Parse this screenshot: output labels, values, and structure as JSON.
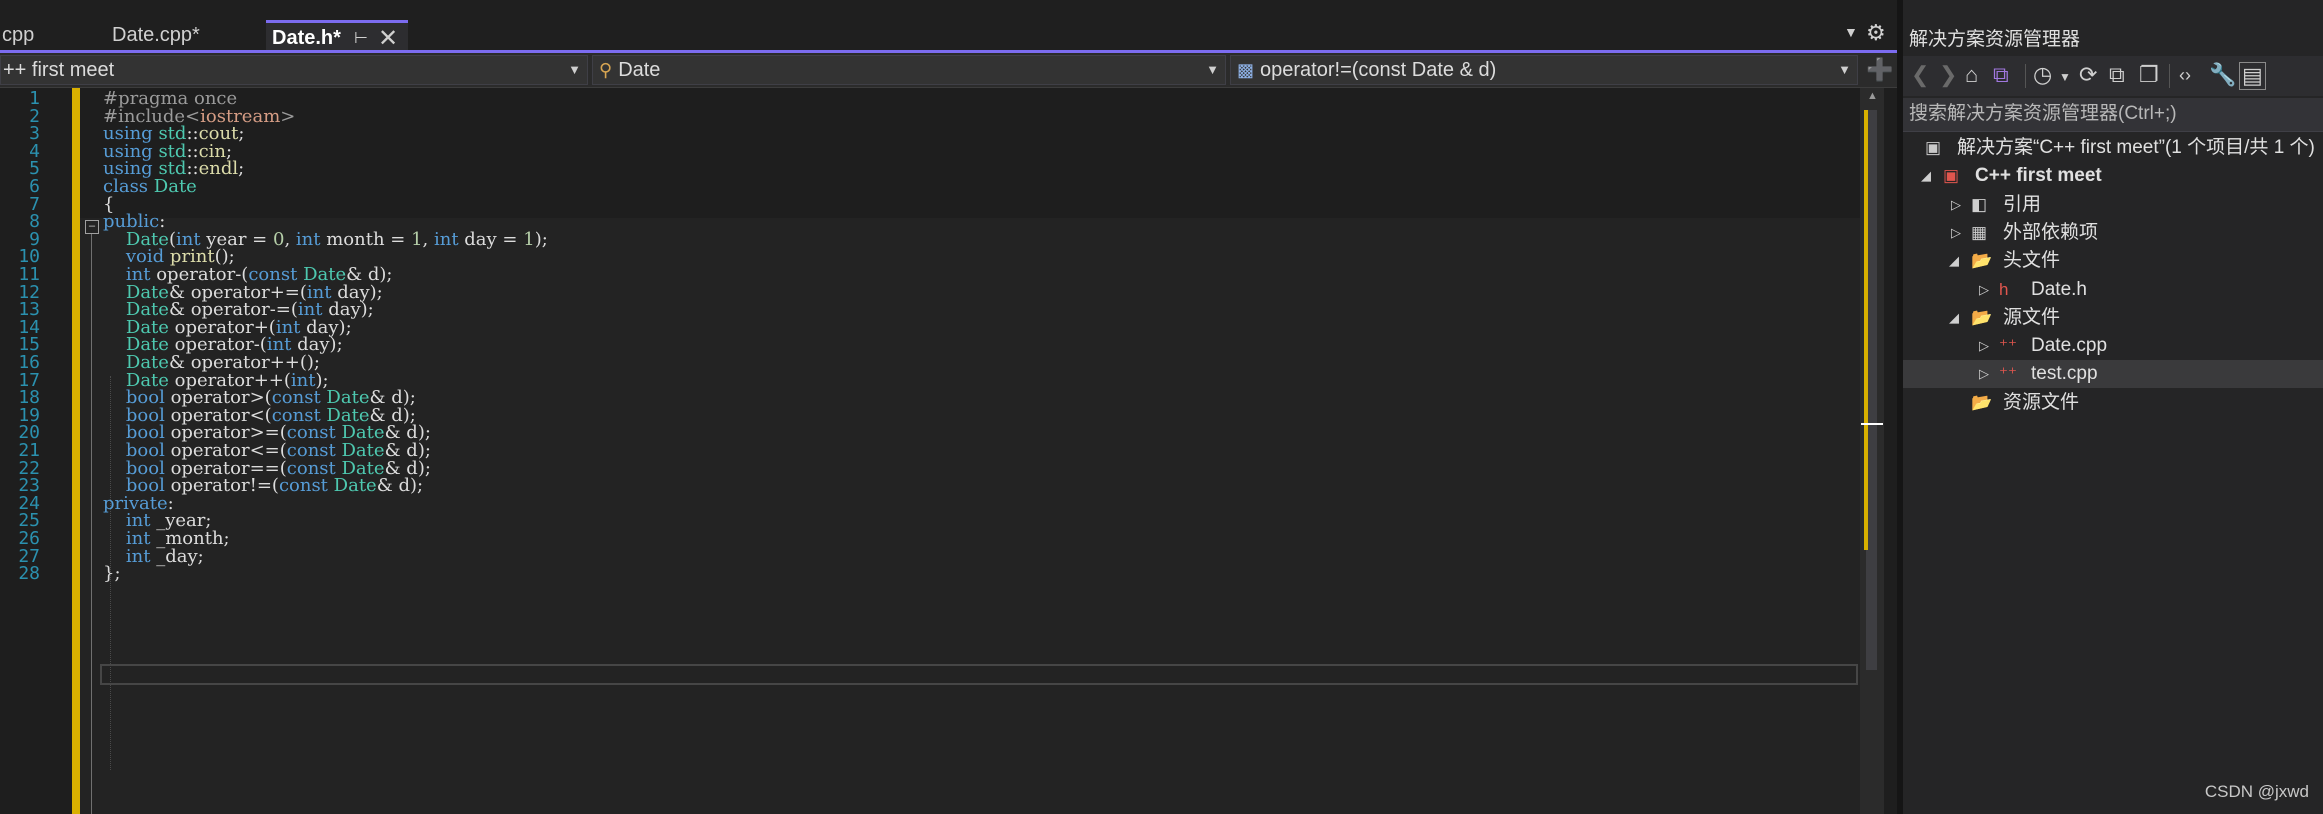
{
  "tabs": [
    {
      "label": "cpp",
      "active": false
    },
    {
      "label": "Date.cpp*",
      "active": false
    },
    {
      "label": "Date.h*",
      "active": true
    }
  ],
  "tab_icons": {
    "pin": "pin-icon",
    "close": "close-icon",
    "dropdown": "chevron-down-icon",
    "settings": "gear-icon"
  },
  "navbar": {
    "project": "++ first meet",
    "class": "Date",
    "member": "operator!=(const Date & d)"
  },
  "editor": {
    "line_numbers": [
      "1",
      "2",
      "3",
      "4",
      "5",
      "6",
      "7",
      "8",
      "9",
      "10",
      "11",
      "12",
      "13",
      "14",
      "15",
      "16",
      "17",
      "18",
      "19",
      "20",
      "21",
      "22",
      "23",
      "24",
      "25",
      "26",
      "27",
      "28"
    ],
    "current_line": "23",
    "code": [
      "#pragma once",
      "#include<iostream>",
      "using std::cout;",
      "using std::cin;",
      "using std::endl;",
      "class Date",
      "{",
      "public:",
      "    Date(int year = 0, int month = 1, int day = 1);",
      "    void print();",
      "    int operator-(const Date& d);",
      "    Date& operator+=(int day);",
      "    Date& operator-=(int day);",
      "    Date operator+(int day);",
      "    Date operator-(int day);",
      "    Date& operator++();",
      "    Date operator++(int);",
      "    bool operator>(const Date& d);",
      "    bool operator<(const Date& d);",
      "    bool operator>=(const Date& d);",
      "    bool operator<=(const Date& d);",
      "    bool operator==(const Date& d);",
      "    bool operator!=(const Date& d);",
      "private:",
      "    int _year;",
      "    int _month;",
      "    int _day;",
      "};"
    ],
    "colors": {
      "keyword": "#569cd6",
      "type": "#4ec9b0",
      "function": "#dcdcaa",
      "preprocessor": "#9b9b9b",
      "string": "#d69d85",
      "number": "#b5cea8",
      "change_marker": "#d9b000"
    }
  },
  "solution_explorer": {
    "title": "解决方案资源管理器",
    "search_placeholder": "搜索解决方案资源管理器(Ctrl+;)",
    "toolbar_icons": [
      "back-icon",
      "forward-icon",
      "home-icon",
      "vs-switch-views-icon",
      "history-icon",
      "chevron-down-icon",
      "sync-icon",
      "collapse-all-icon",
      "copy-icon",
      "code-view-icon",
      "wrench-icon",
      "properties-icon"
    ],
    "tree": [
      {
        "label": "解决方案“C++ first meet”(1 个项目/共 1 个)",
        "icon": "solution-icon",
        "expanded": null,
        "level": 0,
        "bold": false,
        "selected": false
      },
      {
        "label": "C++ first meet",
        "icon": "cpp-project-icon",
        "expanded": true,
        "level": 0,
        "bold": true,
        "selected": false
      },
      {
        "label": "引用",
        "icon": "references-icon",
        "expanded": false,
        "level": 1,
        "bold": false,
        "selected": false
      },
      {
        "label": "外部依赖项",
        "icon": "external-deps-icon",
        "expanded": false,
        "level": 1,
        "bold": false,
        "selected": false
      },
      {
        "label": "头文件",
        "icon": "filter-folder-icon",
        "expanded": true,
        "level": 1,
        "bold": false,
        "selected": false
      },
      {
        "label": "Date.h",
        "icon": "header-file-icon",
        "expanded": false,
        "level": 2,
        "bold": false,
        "selected": false
      },
      {
        "label": "源文件",
        "icon": "filter-folder-icon",
        "expanded": true,
        "level": 1,
        "bold": false,
        "selected": false
      },
      {
        "label": "Date.cpp",
        "icon": "cpp-file-icon",
        "expanded": false,
        "level": 2,
        "bold": false,
        "selected": false
      },
      {
        "label": "test.cpp",
        "icon": "cpp-file-icon",
        "expanded": false,
        "level": 2,
        "bold": false,
        "selected": true
      },
      {
        "label": "资源文件",
        "icon": "filter-folder-icon",
        "expanded": null,
        "level": 1,
        "bold": false,
        "selected": false
      }
    ]
  },
  "watermark": "CSDN @jxwd"
}
